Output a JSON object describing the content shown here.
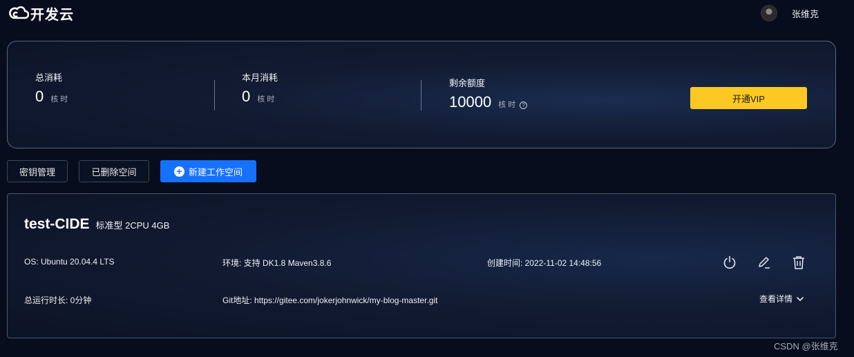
{
  "header": {
    "logo_text": "开发云",
    "user_name": "张维克"
  },
  "stats": {
    "total": {
      "label": "总消耗",
      "value": "0",
      "unit": "核时"
    },
    "monthly": {
      "label": "本月消耗",
      "value": "0",
      "unit": "核时"
    },
    "remaining": {
      "label": "剩余额度",
      "value": "10000",
      "unit": "核时"
    },
    "vip_button": "开通VIP"
  },
  "actions": {
    "keys": "密钥管理",
    "deleted": "已删除空间",
    "new_workspace": "新建工作空间"
  },
  "workspace": {
    "name": "test-CIDE",
    "spec": "标准型 2CPU 4GB",
    "os": "OS: Ubuntu 20.04.4 LTS",
    "env": "环境: 支持 DK1.8 Maven3.8.6",
    "created": "创建时间: 2022-11-02 14:48:56",
    "runtime": "总运行时长: 0分钟",
    "git": "Git地址: https://gitee.com/jokerjohnwick/my-blog-master.git",
    "details": "查看详情"
  },
  "colors": {
    "accent": "#1671ff",
    "vip": "#fcc823",
    "background": "#070d1d"
  },
  "watermark": "CSDN @张维克"
}
